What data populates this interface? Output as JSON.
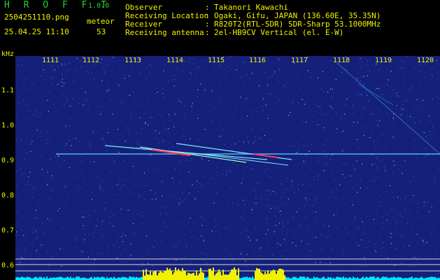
{
  "header": {
    "app_title": "H R O F F T",
    "version": "1.0.0",
    "file_name": "2504251110.png",
    "datetime": "25.04.25 11:10",
    "event_type": "meteor",
    "event_count": "53",
    "info": [
      {
        "key": "Observer",
        "value": "Takanori Kawachi"
      },
      {
        "key": "Receiving Location",
        "value": "Ogaki, Gifu, JAPAN (136.60E, 35.35N)"
      },
      {
        "key": "Receiver",
        "value": "R820T2(RTL-SDR) SDR-Sharp 53.1000MHz"
      },
      {
        "key": "Receiving antenna",
        "value": "2el-HB9CV Vertical (el. E-W)"
      }
    ]
  },
  "plot": {
    "y_unit": "kHz",
    "y_ticks": [
      "1.1",
      "1.0",
      "0.9",
      "0.8",
      "0.7",
      "0.6"
    ],
    "x_ticks": [
      "1111",
      "1112",
      "1113",
      "1114",
      "1115",
      "1116",
      "1117",
      "1118",
      "1119",
      "1120"
    ],
    "colors": {
      "background": "#14207a",
      "noise_light": "#3d4fc0",
      "carrier": "#5fd0ff",
      "meteor_hot": "#ff3060",
      "axis_text": "#f2f200",
      "bottom_bar": "#00e6ff",
      "level_bar": "#f0f000"
    }
  }
}
